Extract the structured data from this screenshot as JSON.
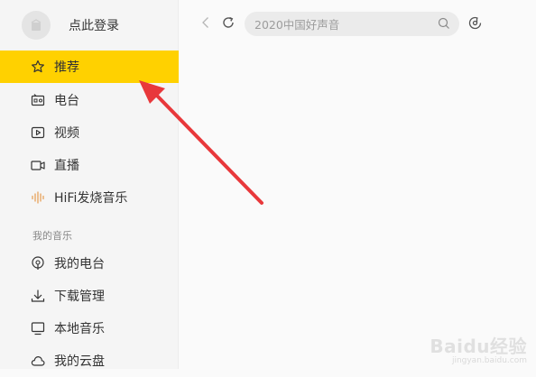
{
  "sidebar": {
    "login_label": "点此登录",
    "items": [
      {
        "label": "推荐",
        "icon": "star-icon",
        "active": true
      },
      {
        "label": "电台",
        "icon": "radio-icon"
      },
      {
        "label": "视频",
        "icon": "video-icon"
      },
      {
        "label": "直播",
        "icon": "camera-icon"
      },
      {
        "label": "HiFi发烧音乐",
        "icon": "equalizer-icon"
      }
    ],
    "section_label": "我的音乐",
    "my_items": [
      {
        "label": "我的电台",
        "icon": "podcast-icon"
      },
      {
        "label": "下载管理",
        "icon": "download-icon"
      },
      {
        "label": "本地音乐",
        "icon": "monitor-icon"
      },
      {
        "label": "我的云盘",
        "icon": "cloud-icon"
      }
    ]
  },
  "toolbar": {
    "search_placeholder": "2020中国好声音"
  },
  "watermark": {
    "logo": "Baidu经验",
    "url": "jingyan.baidu.com"
  },
  "colors": {
    "accent": "#ffd100",
    "annotation_arrow": "#e8383b"
  }
}
